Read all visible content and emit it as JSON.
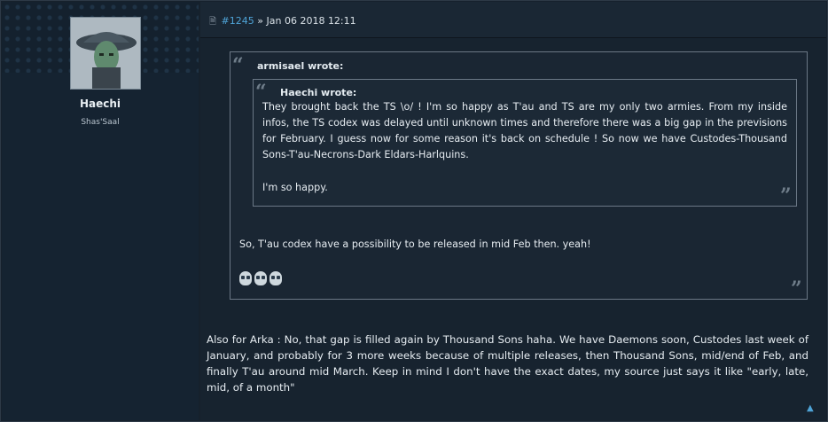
{
  "user": {
    "name": "Haechi",
    "rank": "Shas'Saal"
  },
  "post": {
    "number": "#1245",
    "separator": "»",
    "date": "Jan 06 2018 12:11"
  },
  "outer_quote": {
    "author": "armisael wrote:",
    "reply": "So, T'au codex have a possibility to be released in mid Feb then. yeah!",
    "emoji_count": 3
  },
  "inner_quote": {
    "author": "Haechi wrote:",
    "text": "They brought back the TS \\o/ ! I'm so happy as T'au and TS are my only two armies. From my inside infos, the TS codex was delayed until unknown times and therefore there was a big gap in the previsions for February. I guess now for some reason it's back on schedule ! So now we have Custodes-Thousand Sons-T'au-Necrons-Dark Eldars-Harlquins.",
    "text2": "I'm so happy."
  },
  "message": "Also for Arka : No, that gap is filled again by Thousand Sons haha. We have Daemons soon, Custodes last week of January, and probably for 3 more weeks because of multiple releases, then Thousand Sons, mid/end of Feb, and finally T'au around mid March. Keep in mind I don't have the exact dates, my source just says it like \"early, late, mid, of a month\"",
  "icons": {
    "post": "document-icon",
    "quote_open": "quote-open-icon",
    "quote_close": "quote-close-icon",
    "scroll": "chevron-up-icon",
    "emoji": "skull-emoji-icon"
  },
  "colors": {
    "link": "#4ea3d6",
    "background": "#17232f",
    "sidebar": "#152331",
    "quote_border": "#6b7886"
  }
}
